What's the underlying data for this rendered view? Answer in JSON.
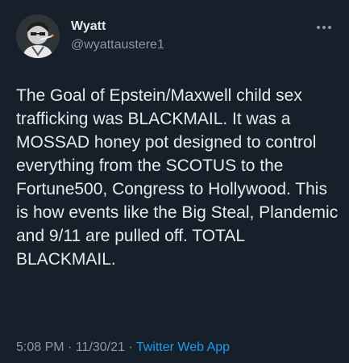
{
  "tweet": {
    "author": {
      "display_name": "Wyatt",
      "handle": "@wyattaustere1",
      "avatar_icon": "profile-photo"
    },
    "text": "The Goal of Epstein/Maxwell child sex trafficking was BLACKMAIL. It was a MOSSAD honey pot designed to control everything from the SCOTUS to the Fortune500, Congress to Hollywood. This is how events like the Big Steal, Plandemic and 9/11 are pulled off. TOTAL BLACKMAIL.",
    "time": "5:08 PM",
    "separator": "·",
    "date": "11/30/21",
    "source_app": "Twitter Web App",
    "more_icon": "more-horizontal-icon"
  },
  "colors": {
    "background": "#15202b",
    "primary_text": "#e7e9ea",
    "secondary_text": "#8b98a5",
    "link": "#1d9bf0"
  }
}
